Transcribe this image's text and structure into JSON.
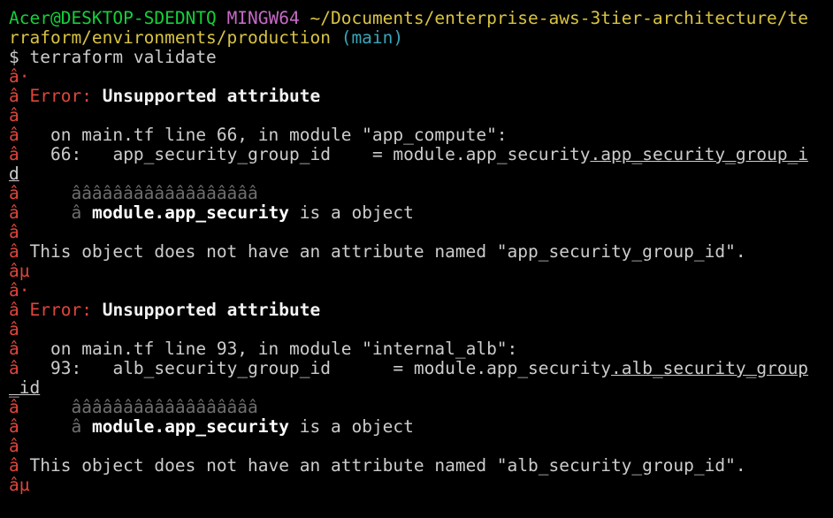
{
  "prompt": {
    "user_host": "Acer@DESKTOP-SDEDNTQ",
    "shell": "MINGW64",
    "path_line1": "~/Documents/enterprise-aws-3tier-architecture/te",
    "path_line2": "rraform/environments/production",
    "branch": "(main)"
  },
  "command": "$ terraform validate",
  "errors": [
    {
      "top_bar": "â·",
      "bar": "â",
      "error_label": "Error:",
      "title": "Unsupported attribute",
      "location": "on main.tf line 66, in module \"app_compute\":",
      "line_no": "66:",
      "code_left": "app_security_group_id    = module.app_security",
      "code_underlined": ".app_security_group_i",
      "wrap_underlined": "d",
      "wrap_rest": "",
      "squiggle": "ââââââââââââââââââ",
      "detail_prefix": "â",
      "detail_bold": "module.app_security",
      "detail_rest": "is a object",
      "message": "This object does not have an attribute named \"app_security_group_id\".",
      "end_bar": "âµ"
    },
    {
      "top_bar": "â·",
      "bar": "â",
      "error_label": "Error:",
      "title": "Unsupported attribute",
      "location": "on main.tf line 93, in module \"internal_alb\":",
      "line_no": "93:",
      "code_left": "alb_security_group_id      = module.app_security",
      "code_underlined": ".alb_security_group",
      "wrap_underlined": "_id",
      "wrap_rest": "",
      "squiggle": "ââââââââââââââââââ",
      "detail_prefix": "â",
      "detail_bold": "module.app_security",
      "detail_rest": "is a object",
      "message": "This object does not have an attribute named \"alb_security_group_id\".",
      "end_bar": "âµ"
    }
  ]
}
